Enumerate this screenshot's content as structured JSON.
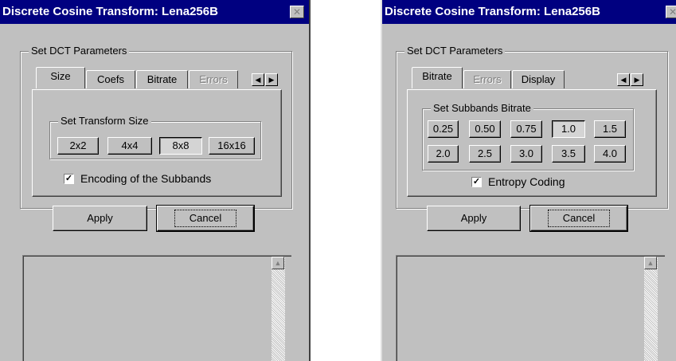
{
  "left_window": {
    "title": "Discrete Cosine Transform: Lena256B",
    "close_glyph": "✕",
    "group_label": "Set DCT Parameters",
    "tabs": [
      {
        "label": "Size",
        "active": true,
        "disabled": false
      },
      {
        "label": "Coefs",
        "active": false,
        "disabled": false
      },
      {
        "label": "Bitrate",
        "active": false,
        "disabled": false
      },
      {
        "label": "Errors",
        "active": false,
        "disabled": true
      }
    ],
    "inner_group_label": "Set Transform Size",
    "size_buttons": [
      {
        "label": "2x2",
        "pressed": false
      },
      {
        "label": "4x4",
        "pressed": false
      },
      {
        "label": "8x8",
        "pressed": true
      },
      {
        "label": "16x16",
        "pressed": false
      }
    ],
    "checkbox": {
      "label": "Encoding of the Subbands",
      "checked": true
    },
    "apply_label": "Apply",
    "cancel_label": "Cancel"
  },
  "right_window": {
    "title": "Discrete Cosine Transform: Lena256B",
    "close_glyph": "✕",
    "group_label": "Set DCT Parameters",
    "tabs": [
      {
        "label": "Bitrate",
        "active": true,
        "disabled": false
      },
      {
        "label": "Errors",
        "active": false,
        "disabled": true
      },
      {
        "label": "Display",
        "active": false,
        "disabled": false
      }
    ],
    "inner_group_label": "Set Subbands Bitrate",
    "bitrate_buttons_row1": [
      {
        "label": "0.25",
        "pressed": false
      },
      {
        "label": "0.50",
        "pressed": false
      },
      {
        "label": "0.75",
        "pressed": false
      },
      {
        "label": "1.0",
        "pressed": true
      },
      {
        "label": "1.5",
        "pressed": false
      }
    ],
    "bitrate_buttons_row2": [
      {
        "label": "2.0",
        "pressed": false
      },
      {
        "label": "2.5",
        "pressed": false
      },
      {
        "label": "3.0",
        "pressed": false
      },
      {
        "label": "3.5",
        "pressed": false
      },
      {
        "label": "4.0",
        "pressed": false
      }
    ],
    "checkbox": {
      "label": "Entropy Coding",
      "checked": true
    },
    "apply_label": "Apply",
    "cancel_label": "Cancel"
  },
  "glyphs": {
    "arrow_left": "◀",
    "arrow_right": "▶",
    "arrow_up": "▲",
    "check": "✓"
  },
  "colors": {
    "titlebar": "#000080",
    "face": "#c0c0c0"
  }
}
